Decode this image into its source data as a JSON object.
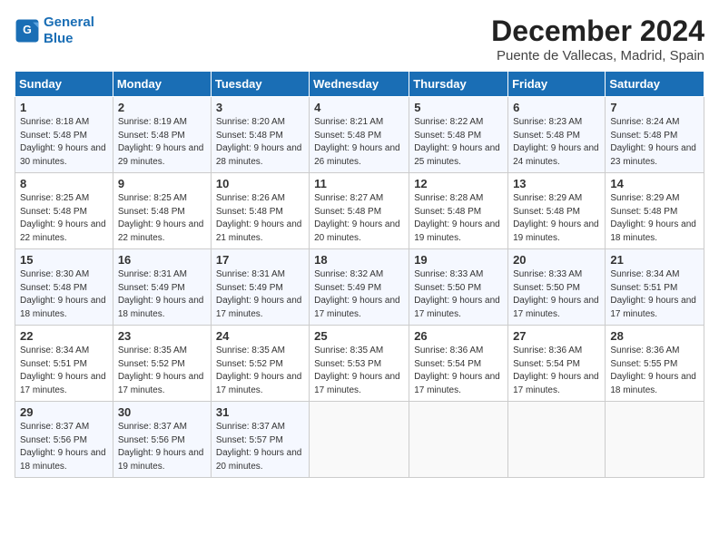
{
  "logo": {
    "line1": "General",
    "line2": "Blue"
  },
  "title": "December 2024",
  "location": "Puente de Vallecas, Madrid, Spain",
  "days_of_week": [
    "Sunday",
    "Monday",
    "Tuesday",
    "Wednesday",
    "Thursday",
    "Friday",
    "Saturday"
  ],
  "weeks": [
    [
      {
        "day": "1",
        "info": "Sunrise: 8:18 AM\nSunset: 5:48 PM\nDaylight: 9 hours and 30 minutes."
      },
      {
        "day": "2",
        "info": "Sunrise: 8:19 AM\nSunset: 5:48 PM\nDaylight: 9 hours and 29 minutes."
      },
      {
        "day": "3",
        "info": "Sunrise: 8:20 AM\nSunset: 5:48 PM\nDaylight: 9 hours and 28 minutes."
      },
      {
        "day": "4",
        "info": "Sunrise: 8:21 AM\nSunset: 5:48 PM\nDaylight: 9 hours and 26 minutes."
      },
      {
        "day": "5",
        "info": "Sunrise: 8:22 AM\nSunset: 5:48 PM\nDaylight: 9 hours and 25 minutes."
      },
      {
        "day": "6",
        "info": "Sunrise: 8:23 AM\nSunset: 5:48 PM\nDaylight: 9 hours and 24 minutes."
      },
      {
        "day": "7",
        "info": "Sunrise: 8:24 AM\nSunset: 5:48 PM\nDaylight: 9 hours and 23 minutes."
      }
    ],
    [
      {
        "day": "8",
        "info": "Sunrise: 8:25 AM\nSunset: 5:48 PM\nDaylight: 9 hours and 22 minutes."
      },
      {
        "day": "9",
        "info": "Sunrise: 8:25 AM\nSunset: 5:48 PM\nDaylight: 9 hours and 22 minutes."
      },
      {
        "day": "10",
        "info": "Sunrise: 8:26 AM\nSunset: 5:48 PM\nDaylight: 9 hours and 21 minutes."
      },
      {
        "day": "11",
        "info": "Sunrise: 8:27 AM\nSunset: 5:48 PM\nDaylight: 9 hours and 20 minutes."
      },
      {
        "day": "12",
        "info": "Sunrise: 8:28 AM\nSunset: 5:48 PM\nDaylight: 9 hours and 19 minutes."
      },
      {
        "day": "13",
        "info": "Sunrise: 8:29 AM\nSunset: 5:48 PM\nDaylight: 9 hours and 19 minutes."
      },
      {
        "day": "14",
        "info": "Sunrise: 8:29 AM\nSunset: 5:48 PM\nDaylight: 9 hours and 18 minutes."
      }
    ],
    [
      {
        "day": "15",
        "info": "Sunrise: 8:30 AM\nSunset: 5:48 PM\nDaylight: 9 hours and 18 minutes."
      },
      {
        "day": "16",
        "info": "Sunrise: 8:31 AM\nSunset: 5:49 PM\nDaylight: 9 hours and 18 minutes."
      },
      {
        "day": "17",
        "info": "Sunrise: 8:31 AM\nSunset: 5:49 PM\nDaylight: 9 hours and 17 minutes."
      },
      {
        "day": "18",
        "info": "Sunrise: 8:32 AM\nSunset: 5:49 PM\nDaylight: 9 hours and 17 minutes."
      },
      {
        "day": "19",
        "info": "Sunrise: 8:33 AM\nSunset: 5:50 PM\nDaylight: 9 hours and 17 minutes."
      },
      {
        "day": "20",
        "info": "Sunrise: 8:33 AM\nSunset: 5:50 PM\nDaylight: 9 hours and 17 minutes."
      },
      {
        "day": "21",
        "info": "Sunrise: 8:34 AM\nSunset: 5:51 PM\nDaylight: 9 hours and 17 minutes."
      }
    ],
    [
      {
        "day": "22",
        "info": "Sunrise: 8:34 AM\nSunset: 5:51 PM\nDaylight: 9 hours and 17 minutes."
      },
      {
        "day": "23",
        "info": "Sunrise: 8:35 AM\nSunset: 5:52 PM\nDaylight: 9 hours and 17 minutes."
      },
      {
        "day": "24",
        "info": "Sunrise: 8:35 AM\nSunset: 5:52 PM\nDaylight: 9 hours and 17 minutes."
      },
      {
        "day": "25",
        "info": "Sunrise: 8:35 AM\nSunset: 5:53 PM\nDaylight: 9 hours and 17 minutes."
      },
      {
        "day": "26",
        "info": "Sunrise: 8:36 AM\nSunset: 5:54 PM\nDaylight: 9 hours and 17 minutes."
      },
      {
        "day": "27",
        "info": "Sunrise: 8:36 AM\nSunset: 5:54 PM\nDaylight: 9 hours and 17 minutes."
      },
      {
        "day": "28",
        "info": "Sunrise: 8:36 AM\nSunset: 5:55 PM\nDaylight: 9 hours and 18 minutes."
      }
    ],
    [
      {
        "day": "29",
        "info": "Sunrise: 8:37 AM\nSunset: 5:56 PM\nDaylight: 9 hours and 18 minutes."
      },
      {
        "day": "30",
        "info": "Sunrise: 8:37 AM\nSunset: 5:56 PM\nDaylight: 9 hours and 19 minutes."
      },
      {
        "day": "31",
        "info": "Sunrise: 8:37 AM\nSunset: 5:57 PM\nDaylight: 9 hours and 20 minutes."
      },
      {
        "day": "",
        "info": ""
      },
      {
        "day": "",
        "info": ""
      },
      {
        "day": "",
        "info": ""
      },
      {
        "day": "",
        "info": ""
      }
    ]
  ]
}
